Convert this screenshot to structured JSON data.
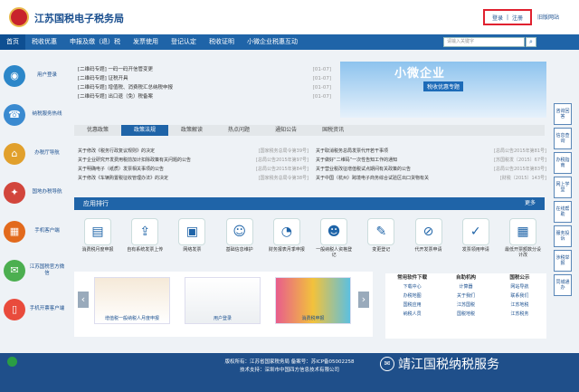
{
  "header": {
    "title": "江苏国税电子税务局",
    "login": "登录",
    "register": "注册",
    "separator": "|",
    "old_site": "旧版网站"
  },
  "nav": [
    "首页",
    "税收优惠",
    "申报及缴（退）税",
    "发票使用",
    "登记认定",
    "税收证明",
    "小微企业税惠互动"
  ],
  "search": {
    "placeholder": "请输入关键字"
  },
  "left": [
    {
      "label": "用户登录",
      "icon": "user-icon",
      "color": "#2c87c9"
    },
    {
      "label": "纳税服务热线",
      "icon": "phone-icon",
      "color": "#3a8ad0"
    },
    {
      "label": "办税厅导航",
      "icon": "map-pin-icon",
      "color": "#e1a02c"
    },
    {
      "label": "国地办税导航",
      "icon": "handshake-icon",
      "color": "#d2463c"
    },
    {
      "label": "手机客户端",
      "icon": "qr-icon",
      "color": "#e26a1d"
    },
    {
      "label": "江苏国税官方微信",
      "icon": "wechat-icon",
      "color": "#4caf50"
    },
    {
      "label": "手机开票客户端",
      "icon": "mobile-icon",
      "color": "#e94b3c"
    }
  ],
  "right": [
    "咨询回答",
    "信息查询",
    "办税指南",
    "网上学堂",
    "在线帮助",
    "服务投诉",
    "涉税举报",
    "同城通办"
  ],
  "qr": [
    {
      "text": "[二维码专题] 一码一码开信管变更",
      "date": "[01-07]"
    },
    {
      "text": "[二维码专题] 证税开具",
      "date": "[01-07]"
    },
    {
      "text": "[二维码专题] 增值税、消费税汇总纳税申报",
      "date": "[01-07]"
    },
    {
      "text": "[二维码专题] 出口退（免）税备案",
      "date": "[01-07]"
    }
  ],
  "banner": {
    "title": "小微企业",
    "subtitle": "税收优惠专题"
  },
  "tabs": [
    "优惠政策",
    "政策法规",
    "政策解读",
    "热点问题",
    "通知公告",
    "国税资讯"
  ],
  "news": [
    {
      "text": "关于修改《税务行政复议规则》的决定",
      "date": "[国家税务总局令第39号]"
    },
    {
      "text": "关于取消税务总局发票代开若干事项",
      "date": "[总局公告2015年第81号]"
    },
    {
      "text": "关于企业研究开发费用税前加计扣除政策有关问题的公告",
      "date": "[总局公告2015年第97号]"
    },
    {
      "text": "关于做好“二维码”一次性告知工作的通知",
      "date": "[苏国税发〔2015〕67号]"
    },
    {
      "text": "关于明确电子（纸质）发票相关事项的公告",
      "date": "[总局公告2015年第84号]"
    },
    {
      "text": "关于营业税改征增值税试点期间有关政策的公告",
      "date": "[总局公告2015年第83号]"
    },
    {
      "text": "关于修改《车辆购置税征收管理办法》的决定",
      "date": "[国家税务总局令第38号]"
    },
    {
      "text": "关于中国（杭州）跨境电子商务综合试验区出口货物有关",
      "date": "[财税〔2015〕143号]"
    }
  ],
  "apps_title": "应用排行",
  "more": "更多",
  "apps": [
    {
      "label": "消费税月度申报",
      "icon": "doc-icon"
    },
    {
      "label": "自有系统发票上传",
      "icon": "upload-icon"
    },
    {
      "label": "网络发票",
      "icon": "invoice-icon"
    },
    {
      "label": "基础信息维护",
      "icon": "person-icon"
    },
    {
      "label": "财务报表月季申报",
      "icon": "chart-icon"
    },
    {
      "label": "一般纳税人资格登记",
      "icon": "people-icon"
    },
    {
      "label": "变更登记",
      "icon": "edit-icon"
    },
    {
      "label": "代开发票申请",
      "icon": "stamp-icon"
    },
    {
      "label": "发票领用申请",
      "icon": "receipt-icon"
    },
    {
      "label": "最低开票额数分设计改",
      "icon": "calc-icon"
    }
  ],
  "slides": [
    {
      "caption": "增值税一般纳税人月度申报"
    },
    {
      "caption": "用户登录"
    },
    {
      "caption": "消费税申报"
    }
  ],
  "quick": [
    {
      "head": "常用软件下载",
      "items": [
        "下载中心",
        "办税地图",
        "国税应用",
        "纳税人员"
      ]
    },
    {
      "head": "自助机构",
      "items": [
        "计算器",
        "关于我们",
        "江苏国税",
        "国税地税"
      ]
    },
    {
      "head": "国税公示",
      "items": [
        "网站导航",
        "联系我们",
        "江苏地税",
        "江苏税务"
      ]
    }
  ],
  "footer": {
    "line1": "版权所有：江苏省国家税务局 备案号：苏ICP备05002258",
    "line2": "技术支持：深圳市中国四方信息技术有限公司"
  },
  "watermark": "靖江国税纳税服务"
}
